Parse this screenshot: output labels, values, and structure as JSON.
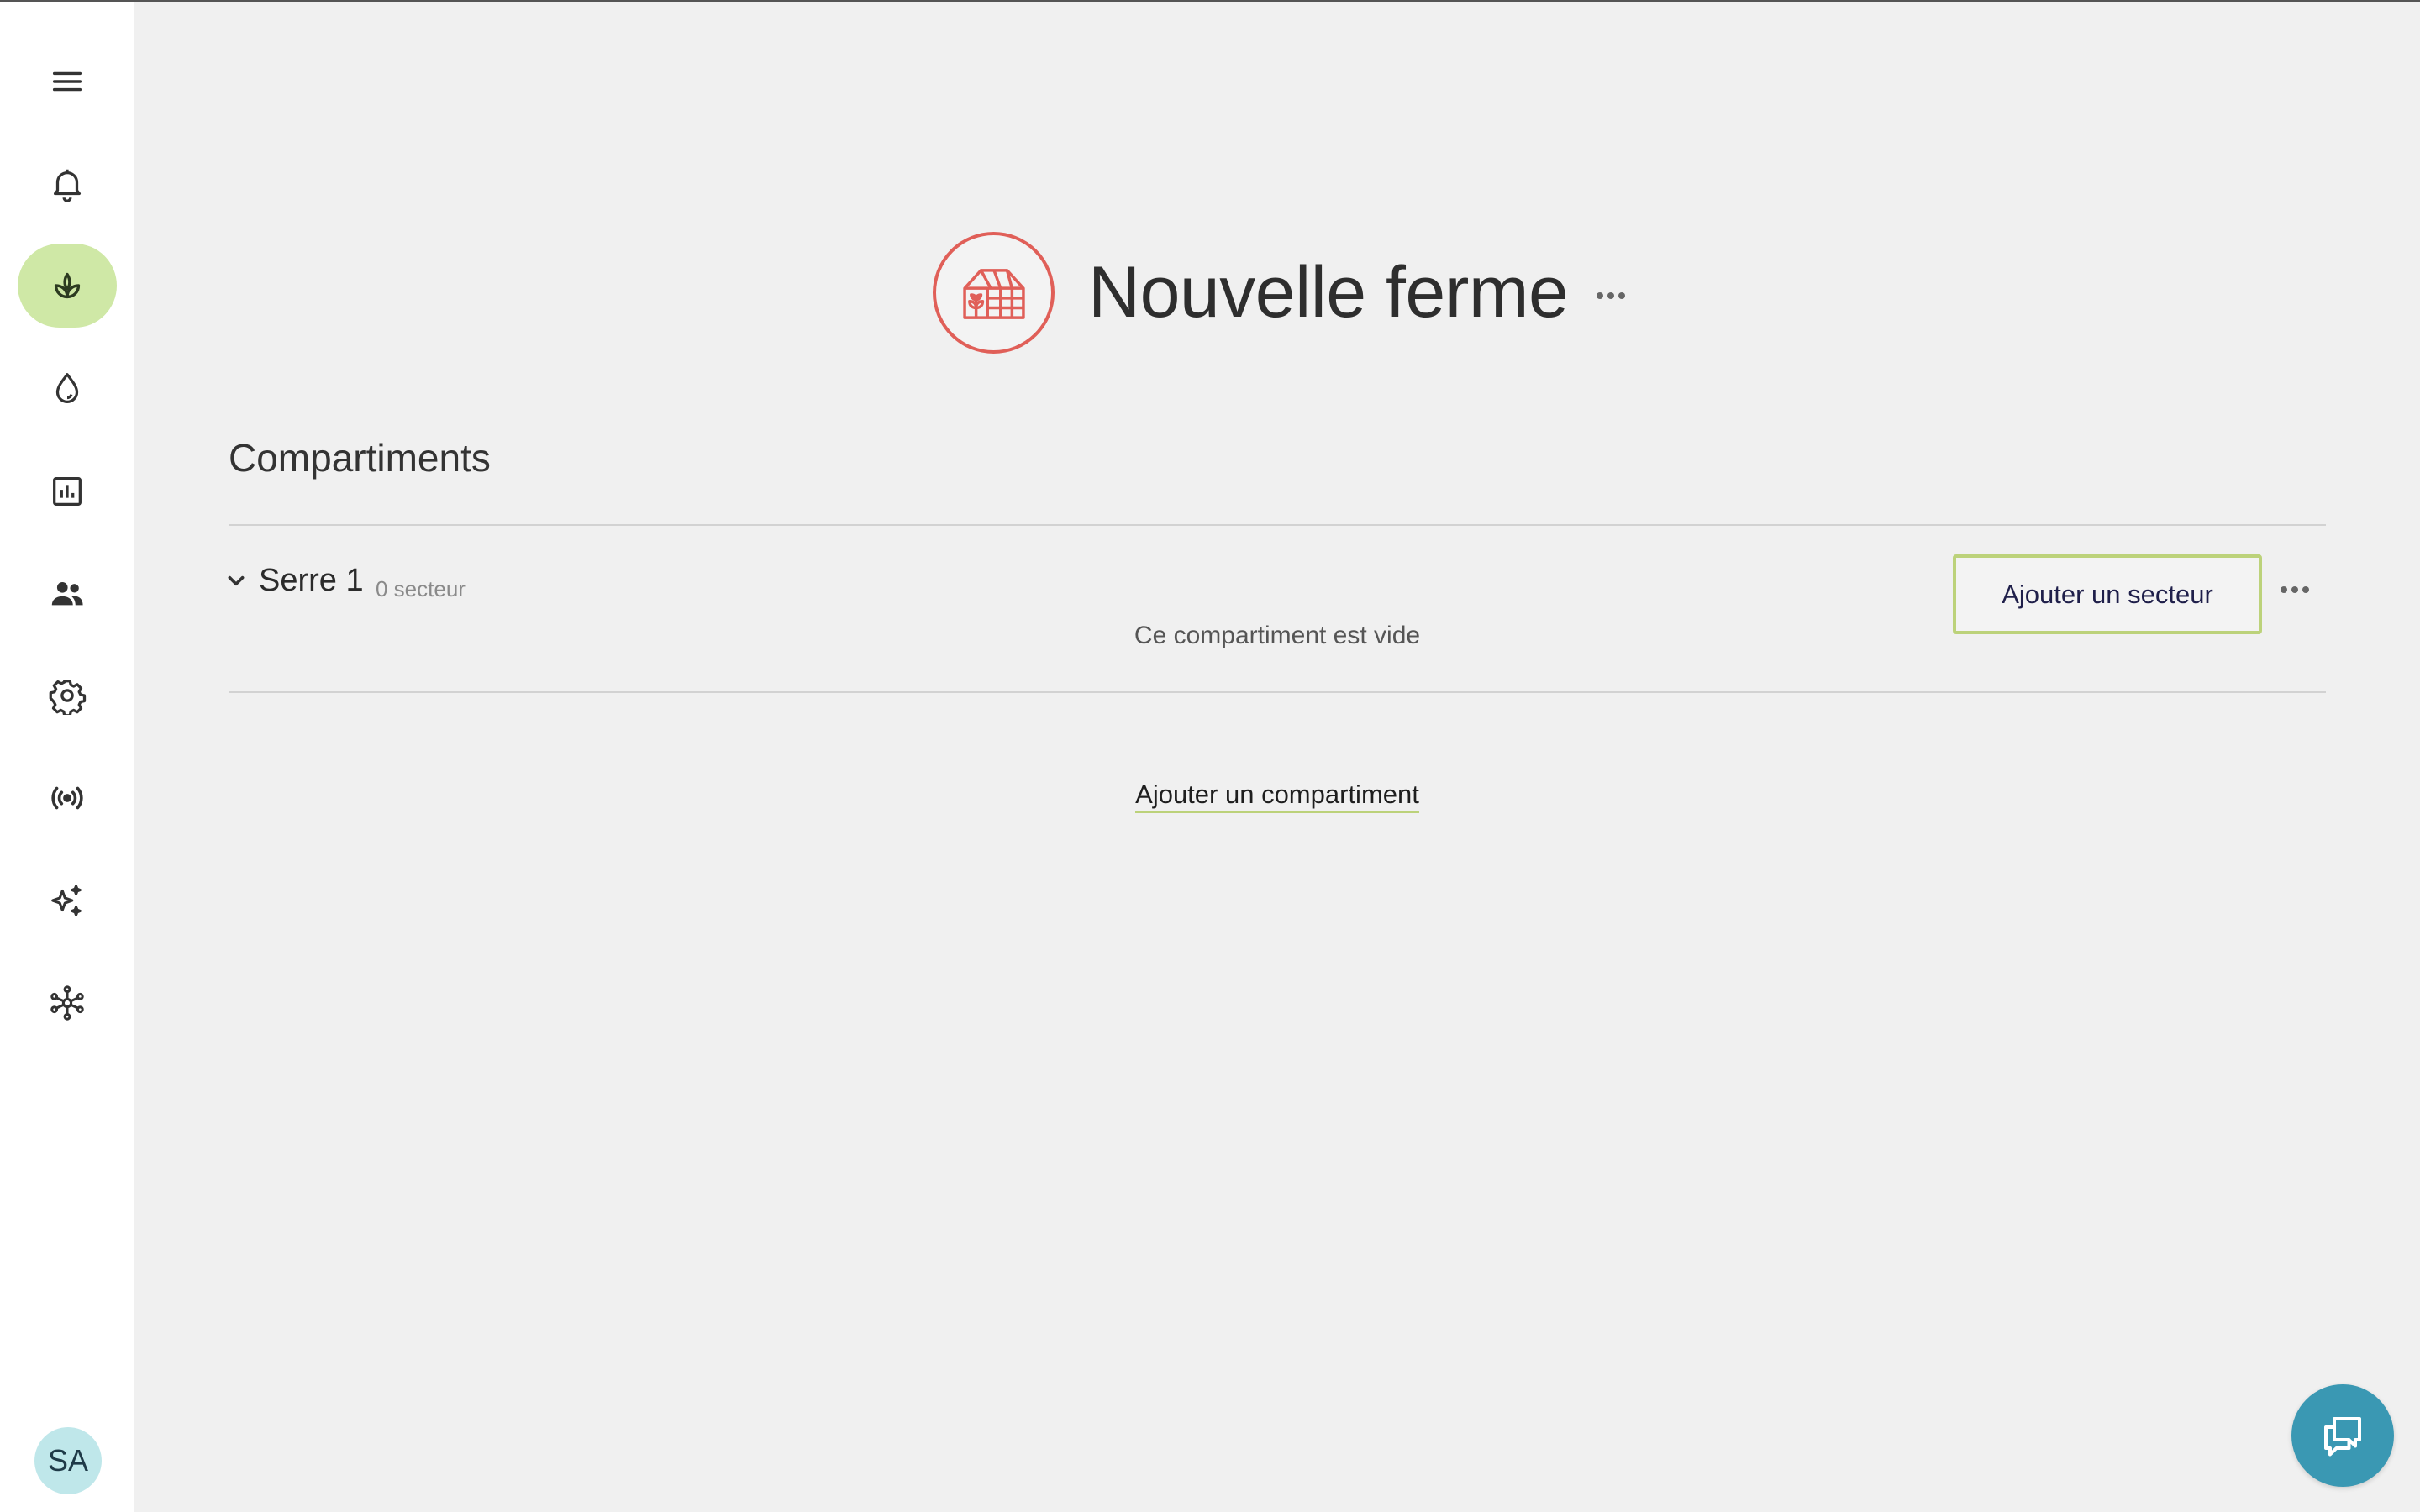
{
  "sidebar": {
    "items": [
      {
        "icon": "menu-icon"
      },
      {
        "icon": "bell-icon"
      },
      {
        "icon": "plant-icon",
        "active": true
      },
      {
        "icon": "water-drop-icon"
      },
      {
        "icon": "chart-icon"
      },
      {
        "icon": "users-icon"
      },
      {
        "icon": "gear-icon"
      },
      {
        "icon": "broadcast-icon"
      },
      {
        "icon": "sparkles-icon"
      },
      {
        "icon": "network-icon"
      }
    ],
    "avatar_initials": "SA",
    "active_color": "#cfe8a6"
  },
  "header": {
    "title": "Nouvelle ferme",
    "logo_icon": "greenhouse-icon",
    "logo_color": "#e05f58"
  },
  "section": {
    "title": "Compartiments"
  },
  "compartments": [
    {
      "name": "Serre 1",
      "count_label": "0 secteur",
      "empty_message": "Ce compartiment est vide",
      "add_sector_label": "Ajouter un secteur"
    }
  ],
  "add_compartment_label": "Ajouter un compartiment",
  "colors": {
    "accent": "#bcd27a",
    "chat": "#3a98b3",
    "background": "#f0f0f0"
  },
  "chat_icon": "chat-bubbles-icon"
}
